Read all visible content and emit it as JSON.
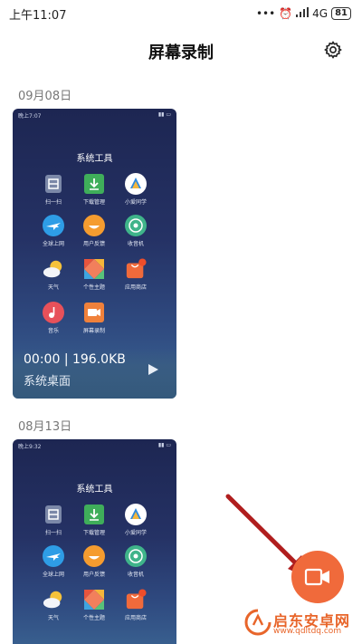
{
  "status_bar": {
    "time": "上午11:07",
    "network": "4G",
    "battery": "81"
  },
  "header": {
    "title": "屏幕录制"
  },
  "recordings": [
    {
      "date": "09月08日",
      "thumb_time": "晚上7:07",
      "thumb_title": "系统工具",
      "duration": "00:00",
      "size": "196.0KB",
      "name": "系统桌面",
      "apps": [
        "扫一扫",
        "下载管理",
        "小爱同学",
        "全球上网",
        "用户反馈",
        "收音机",
        "天气",
        "个性主题",
        "应用商店",
        "音乐",
        "屏幕录制"
      ]
    },
    {
      "date": "08月13日",
      "thumb_time": "晚上9:32",
      "thumb_title": "系统工具",
      "apps": [
        "扫一扫",
        "下载管理",
        "小爱同学",
        "全球上网",
        "用户反馈",
        "收音机",
        "天气",
        "个性主题",
        "应用商店"
      ]
    }
  ],
  "watermark": {
    "name": "启东安卓网",
    "url": "www.qdltdq.com"
  },
  "colors": {
    "accent": "#f06a3b",
    "arrow": "#b01e1e"
  }
}
